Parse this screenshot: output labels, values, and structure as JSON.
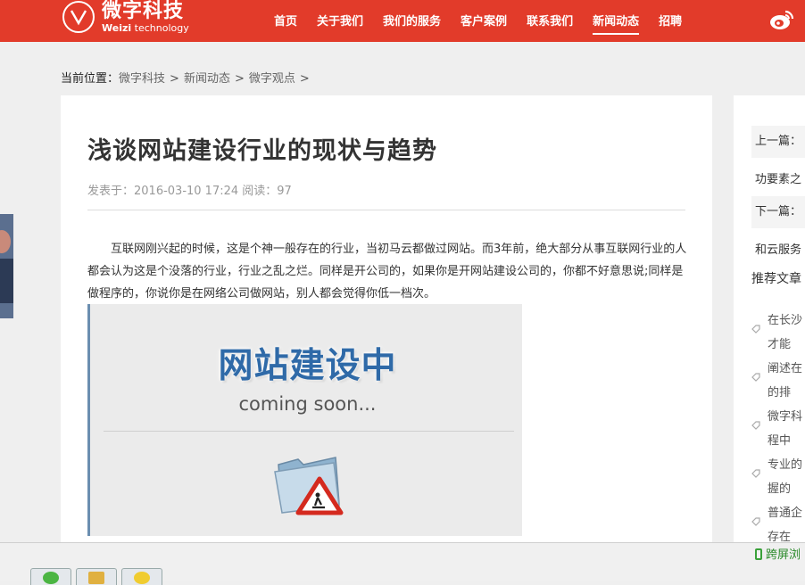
{
  "logo": {
    "cn": "微字科技",
    "en_bold": "Weizi",
    "en_rest": " technology"
  },
  "nav": {
    "items": [
      {
        "label": "首页"
      },
      {
        "label": "关于我们"
      },
      {
        "label": "我们的服务"
      },
      {
        "label": "客户案例"
      },
      {
        "label": "联系我们"
      },
      {
        "label": "新闻动态",
        "active": true
      },
      {
        "label": "招聘"
      }
    ]
  },
  "breadcrumb": {
    "label": "当前位置：",
    "items": [
      "微字科技",
      "新闻动态",
      "微字观点"
    ],
    "sep": ">"
  },
  "article": {
    "title": "浅谈网站建设行业的现状与趋势",
    "meta": "发表于：2016-03-10 17:24 阅读：97",
    "paragraph": "互联网刚兴起的时候，这是个神一般存在的行业，当初马云都做过网站。而3年前，绝大部分从事互联网行业的人都会认为这是个没落的行业，行业之乱之烂。同样是开公司的，如果你是开网站建设公司的，你都不好意思说;同样是做程序的，你说你是在网络公司做网站，别人都会觉得你低一档次。",
    "figure": {
      "title": "网站建设中",
      "subtitle": "coming soon..."
    }
  },
  "sidebar": {
    "prev_label": "上一篇：",
    "prev_text": "功要素之",
    "next_label": "下一篇：",
    "next_text": "和云服务",
    "recommend_label": "推荐文章",
    "recommend": [
      {
        "line1": "在长沙",
        "line2": "才能"
      },
      {
        "line1": "阐述在",
        "line2": "的排"
      },
      {
        "line1": "微字科",
        "line2": "程中"
      },
      {
        "line1": "专业的",
        "line2": "握的"
      },
      {
        "line1": "普通企",
        "line2": "存在"
      }
    ]
  },
  "taskbar": {
    "cross_screen": "跨屏浏"
  },
  "colors": {
    "brand_red": "#e23b2a",
    "figure_title": "#2f6aa8"
  }
}
